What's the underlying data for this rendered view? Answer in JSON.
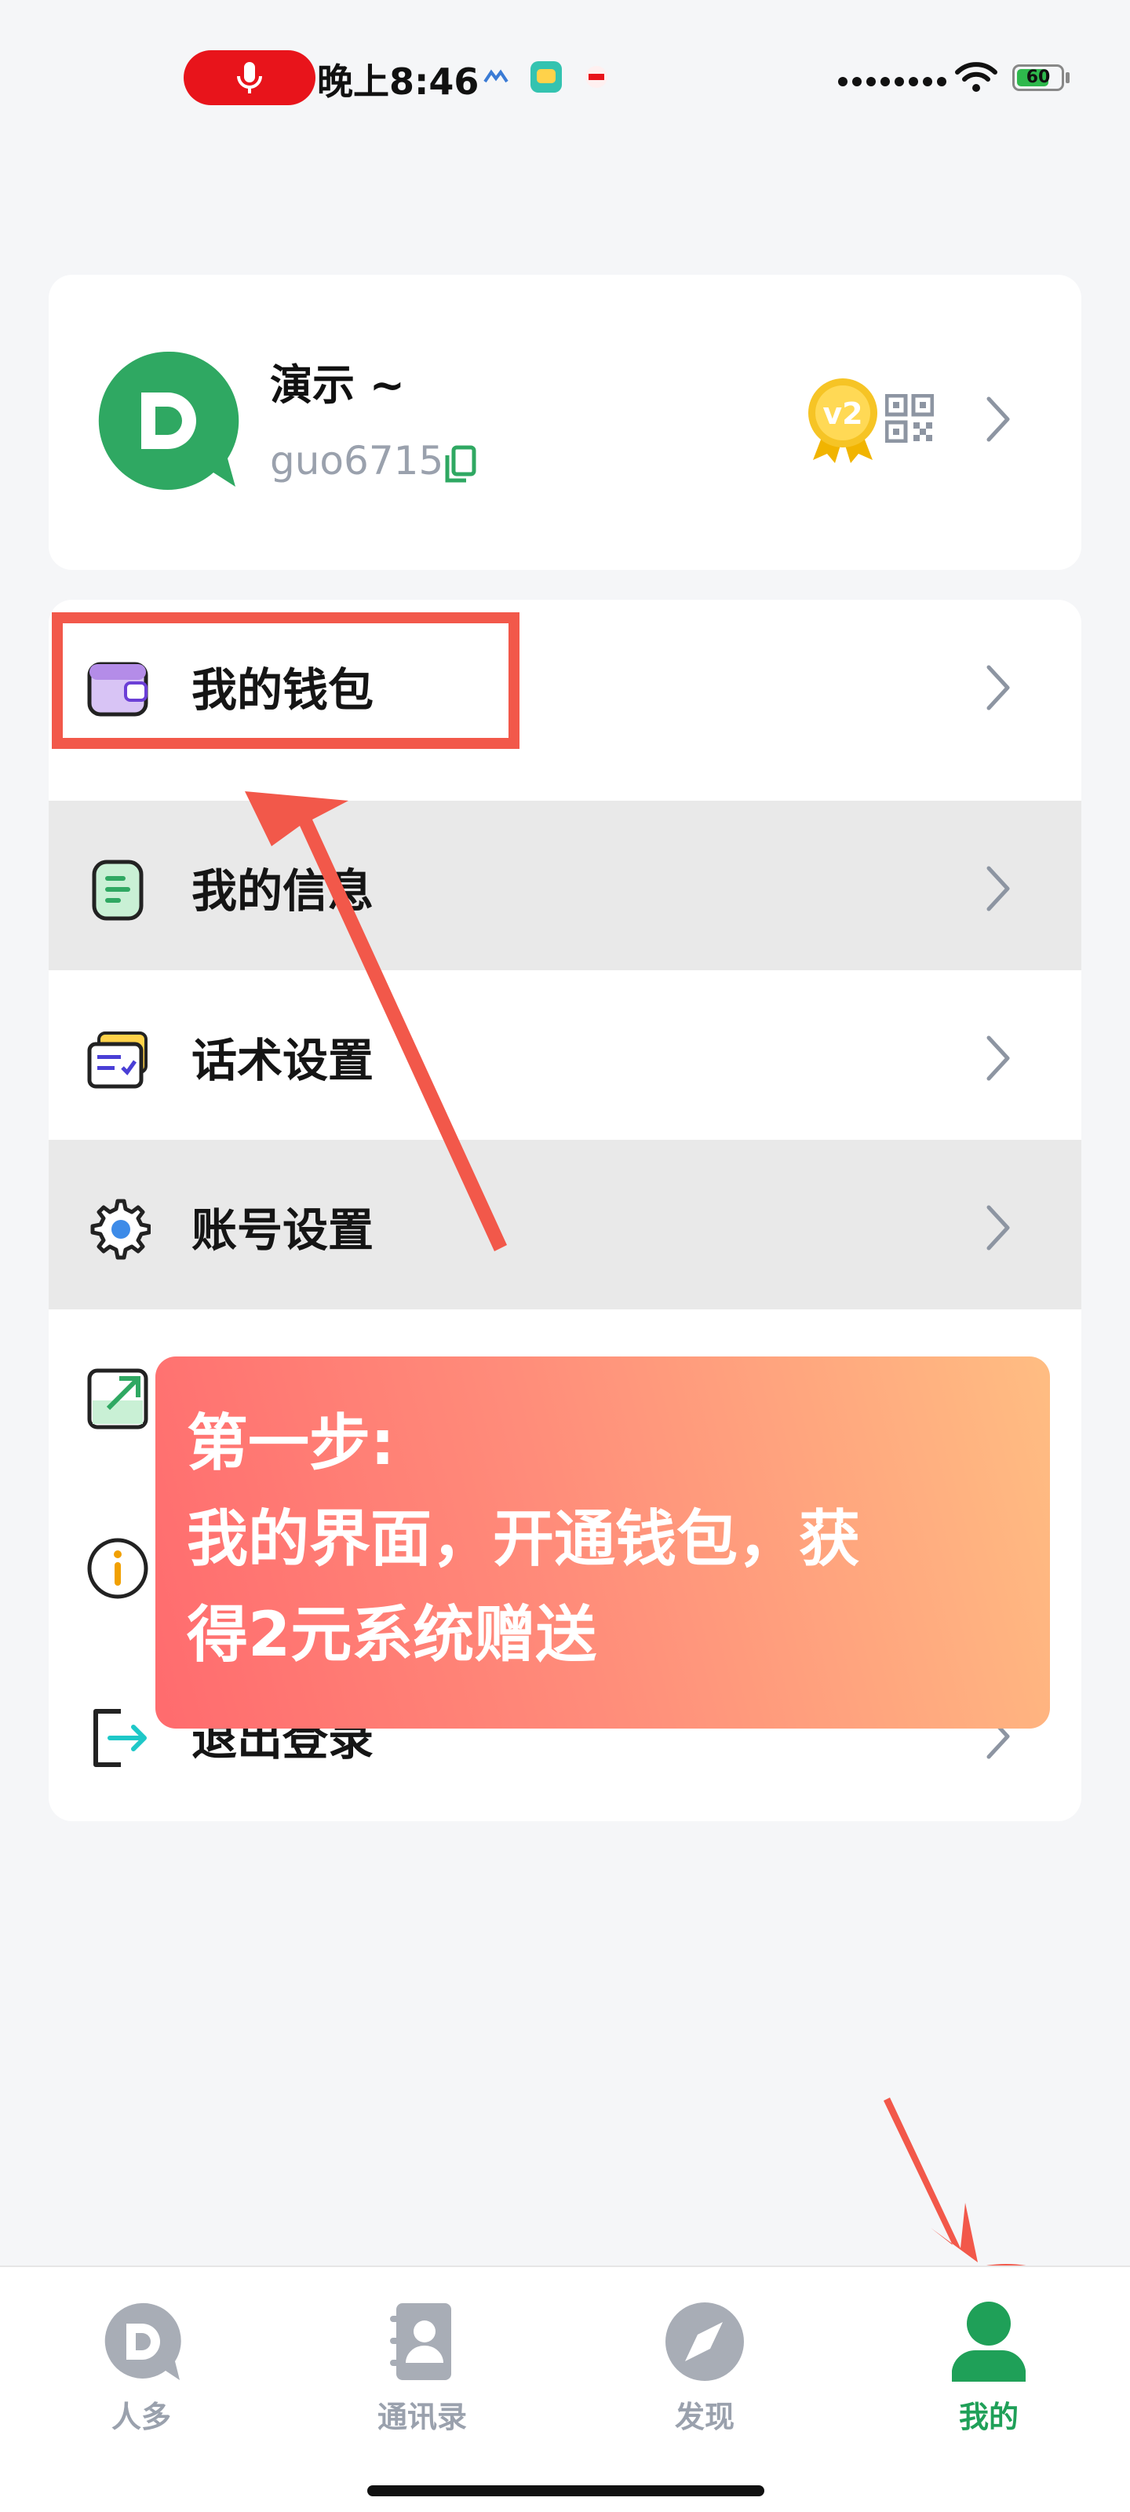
{
  "status_bar": {
    "time": "晚上8:46",
    "battery": "60"
  },
  "profile": {
    "name": "演示 ~",
    "id": "guo6715",
    "vip_level": "v2"
  },
  "menu": {
    "items": [
      {
        "label": "我的钱包"
      },
      {
        "label": "我的信息"
      },
      {
        "label": "话术设置"
      },
      {
        "label": "账号设置"
      },
      {
        "label": "退出登录"
      }
    ]
  },
  "annotation": {
    "lines": [
      "第一步:",
      "我的界面，开通钱包，获",
      "得2元系统赠送"
    ]
  },
  "tabbar": {
    "tabs": [
      {
        "label": "人多",
        "icon": "app-logo-icon"
      },
      {
        "label": "通讯录",
        "icon": "contacts-icon"
      },
      {
        "label": "发现",
        "icon": "compass-icon"
      },
      {
        "label": "我的",
        "icon": "person-icon",
        "active": true
      }
    ]
  },
  "colors": {
    "accent": "#1fa058",
    "annotation_red": "#f2584a",
    "tab_inactive": "#9aa1ad"
  }
}
